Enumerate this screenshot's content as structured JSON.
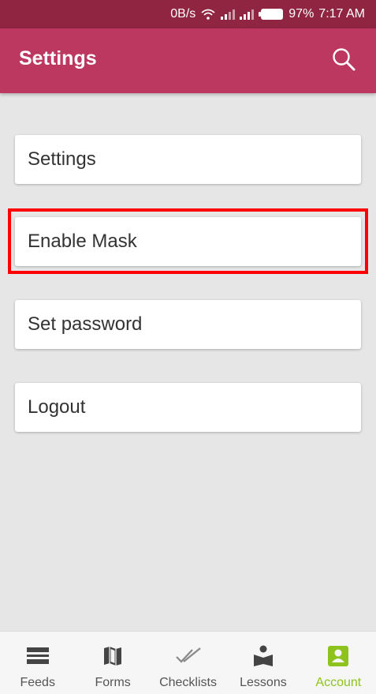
{
  "status_bar": {
    "net_speed": "0B/s",
    "battery_percent": "97%",
    "time": "7:17 AM",
    "icons": [
      "wifi-icon",
      "signal-icon",
      "signal-icon",
      "battery-icon"
    ]
  },
  "header": {
    "title": "Settings",
    "search_icon": "search-icon",
    "color": "#bc3860"
  },
  "menu": {
    "items": [
      {
        "label": "Settings"
      },
      {
        "label": "Enable Mask",
        "highlighted": true
      },
      {
        "label": "Set password"
      },
      {
        "label": "Logout"
      }
    ]
  },
  "bottom_nav": {
    "active_color": "#8dc21f",
    "items": [
      {
        "label": "Feeds",
        "icon": "feeds-icon",
        "active": false
      },
      {
        "label": "Forms",
        "icon": "map-icon",
        "active": false
      },
      {
        "label": "Checklists",
        "icon": "double-check-icon",
        "active": false
      },
      {
        "label": "Lessons",
        "icon": "reader-icon",
        "active": false
      },
      {
        "label": "Account",
        "icon": "account-icon",
        "active": true
      }
    ]
  }
}
